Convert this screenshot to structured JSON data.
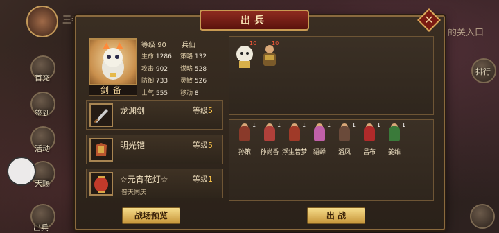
{
  "background": {
    "top_left_text": "王者的王者",
    "top_right_text": "的关入口",
    "right_button": "排行",
    "left_labels": [
      "首充",
      "签到",
      "活动",
      "天赐",
      "出兵"
    ]
  },
  "dialog": {
    "title": "出兵",
    "close_icon": "close-icon"
  },
  "hero": {
    "name": "剑备",
    "level_label": "等级",
    "level_value": "90",
    "class": "兵仙",
    "stats": {
      "hp_label": "生命",
      "hp_value": "1286",
      "strategy_label": "策略",
      "strategy_value": "132",
      "attack_label": "攻击",
      "attack_value": "902",
      "tactics_label": "谋略",
      "tactics_value": "528",
      "defense_label": "防御",
      "defense_value": "733",
      "agility_label": "灵敏",
      "agility_value": "526",
      "morale_label": "士气",
      "morale_value": "555",
      "move_label": "移动",
      "move_value": "8"
    }
  },
  "equipment": [
    {
      "name": "龙渊剑",
      "level_label": "等级",
      "level": "5",
      "icon": "sword-icon",
      "subtitle": ""
    },
    {
      "name": "明光铠",
      "level_label": "等级",
      "level": "5",
      "icon": "armor-icon",
      "subtitle": ""
    },
    {
      "name": "☆元宵花灯☆",
      "level_label": "等级",
      "level": "1",
      "icon": "lantern-icon",
      "subtitle": "普天同庆"
    }
  ],
  "deployed": [
    {
      "count": "10"
    },
    {
      "count": "10"
    }
  ],
  "reserve": [
    {
      "name": "孙策",
      "count": "1",
      "color": "#8a3a2a"
    },
    {
      "name": "孙尚香",
      "count": "1",
      "color": "#b0403a"
    },
    {
      "name": "浮生若梦",
      "count": "1",
      "color": "#a03a28"
    },
    {
      "name": "貂蝉",
      "count": "1",
      "color": "#c060a8"
    },
    {
      "name": "潘凤",
      "count": "1",
      "color": "#6a4a3a"
    },
    {
      "name": "吕布",
      "count": "1",
      "color": "#b02a2a"
    },
    {
      "name": "姜维",
      "count": "1",
      "color": "#3a7a3a"
    }
  ],
  "buttons": {
    "preview": "战场预览",
    "deploy": "出 战"
  }
}
